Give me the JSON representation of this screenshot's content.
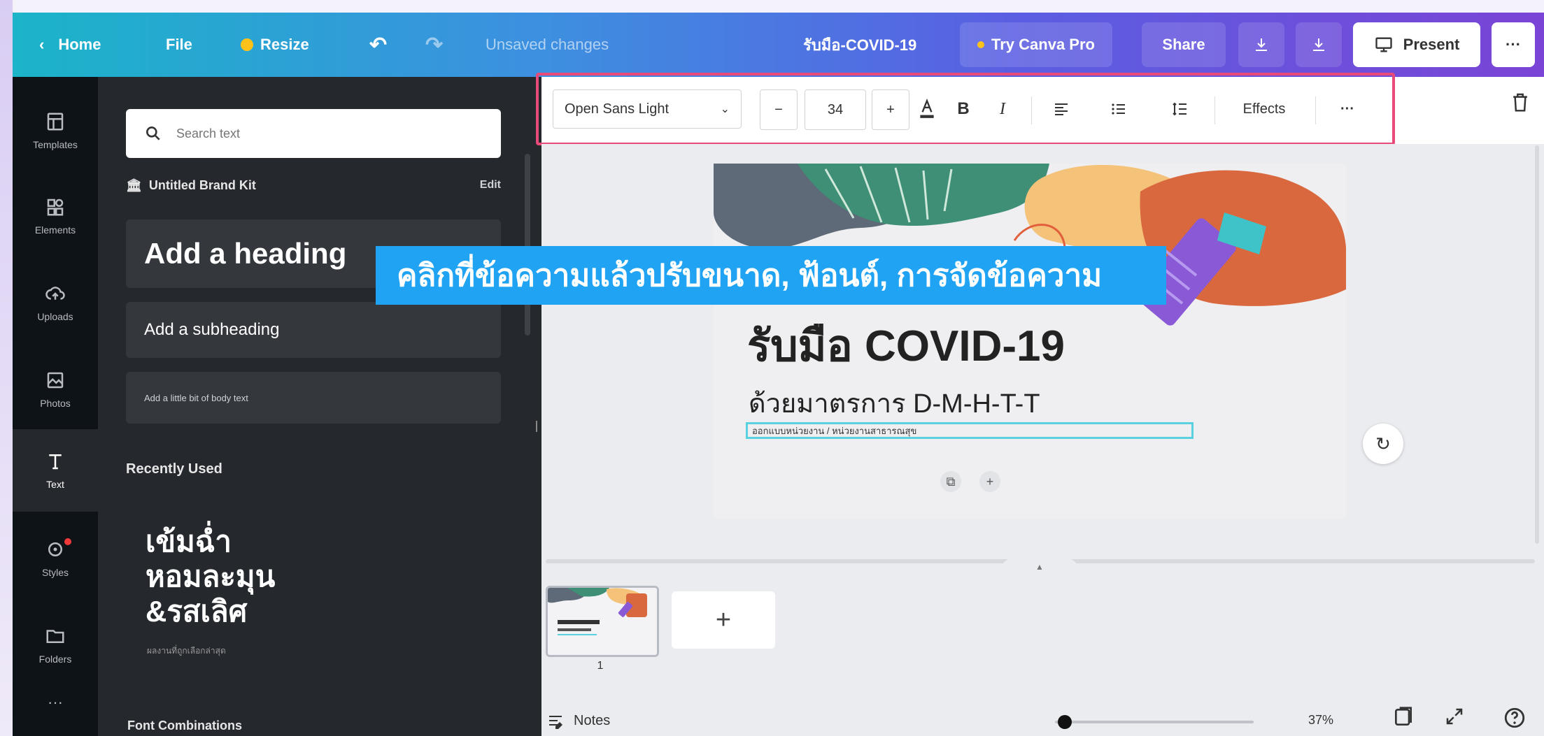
{
  "topbar": {
    "home": "Home",
    "file": "File",
    "resize": "Resize",
    "status": "Unsaved changes",
    "doc_title": "รับมือ-COVID-19",
    "try_pro": "Try Canva Pro",
    "share": "Share",
    "present": "Present",
    "more": "···"
  },
  "rail": [
    {
      "label": "Templates",
      "icon": "templates-icon"
    },
    {
      "label": "Elements",
      "icon": "elements-icon"
    },
    {
      "label": "Uploads",
      "icon": "uploads-icon"
    },
    {
      "label": "Photos",
      "icon": "photos-icon"
    },
    {
      "label": "Text",
      "icon": "text-icon"
    },
    {
      "label": "Styles",
      "icon": "styles-icon"
    },
    {
      "label": "Folders",
      "icon": "folders-icon"
    },
    {
      "label": "···",
      "icon": "more-icon"
    }
  ],
  "panel": {
    "search_placeholder": "Search text",
    "brand_kit": "Untitled Brand Kit",
    "brand_edit": "Edit",
    "add_heading": "Add a heading",
    "add_subheading": "Add a subheading",
    "add_body": "Add a little bit of body text",
    "recently_used": "Recently Used",
    "sample_line1": "เข้มฉ่ำ",
    "sample_line2": "หอมละมุน",
    "sample_line3": "&รสเลิศ",
    "sample_small": "ผลงานที่ถูกเลือกล่าสุด",
    "font_combinations": "Font Combinations"
  },
  "toolbar": {
    "font": "Open Sans Light",
    "minus": "−",
    "size": "34",
    "plus": "+",
    "bold": "B",
    "italic": "I",
    "effects": "Effects",
    "more": "···"
  },
  "canvas": {
    "headline": "รับมือ COVID-19",
    "subline": "ด้วยมาตรการ D-M-H-T-T",
    "small_text": "ออกแบบหน่วยงาน / หน่วยงานสาธารณสุข"
  },
  "banner": {
    "text": "คลิกที่ข้อความแล้วปรับขนาด, ฟ้อนต์, การจัดข้อความ"
  },
  "bottom": {
    "page_number": "1",
    "add_page": "+",
    "notes": "Notes",
    "zoom": "37%",
    "zoom_fraction": 0.05
  },
  "colors": {
    "accent_pink": "#e84a7a",
    "banner_blue": "#1fa3f2",
    "teal_select": "#59d1de"
  }
}
